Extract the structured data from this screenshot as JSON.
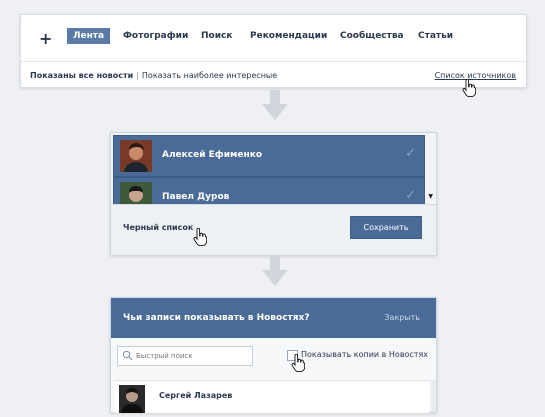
{
  "tabs": {
    "plus": "+",
    "items": [
      "Лента",
      "Фотографии",
      "Поиск",
      "Рекомендации",
      "Сообщества",
      "Статьи"
    ],
    "active": "Лента"
  },
  "filter": {
    "shown_all": "Показаны все новости",
    "separator": "|",
    "show_interesting": "Показать наиболее интересные",
    "sources_link": "Список источников"
  },
  "list": {
    "users": [
      {
        "name": "Алексей Ефименко",
        "checked": true
      },
      {
        "name": "Павел Дуров",
        "checked": true
      }
    ],
    "check_glyph": "✓",
    "scroll_glyph": "▼",
    "black_list": "Черный список",
    "save_label": "Сохранить"
  },
  "dialog": {
    "title": "Чьи записи показывать в Новостях?",
    "close_label": "Закрыть",
    "search_placeholder": "Быстрый поиск",
    "show_copies_label": "Показывать копии в Новостях",
    "rows": [
      {
        "name": "Сергей Лазарев"
      }
    ]
  },
  "colors": {
    "accent": "#4a6a97",
    "active_tab": "#5b7ba7",
    "background": "#eef0f3",
    "text": "#2b3a4f"
  },
  "icons": [
    "plus-icon",
    "hand-cursor-icon",
    "down-arrow-icon",
    "check-icon",
    "search-icon"
  ]
}
